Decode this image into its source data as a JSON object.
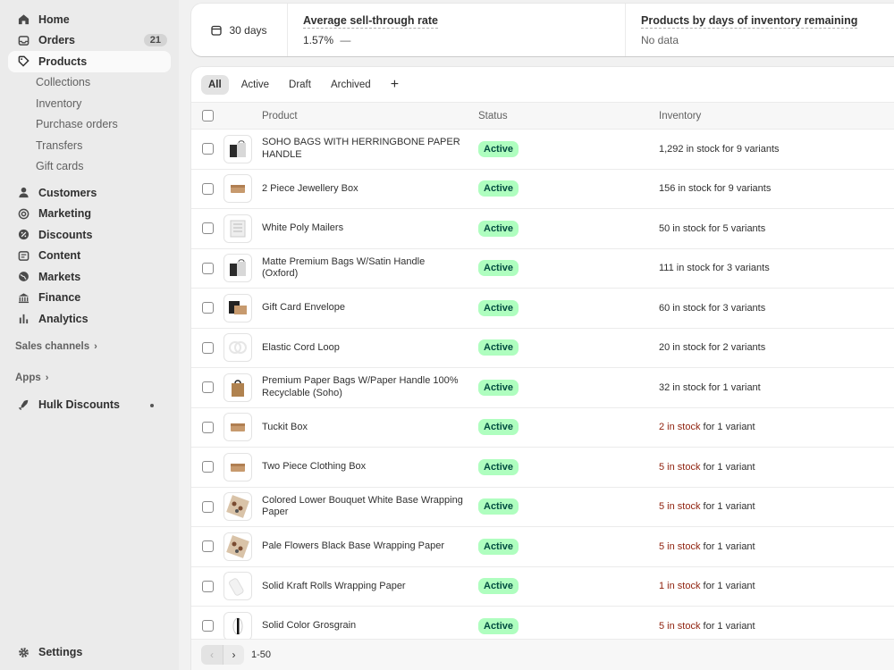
{
  "sidebar": {
    "items": [
      {
        "label": "Home"
      },
      {
        "label": "Orders",
        "badge": "21"
      },
      {
        "label": "Products"
      },
      {
        "label": "Customers"
      },
      {
        "label": "Marketing"
      },
      {
        "label": "Discounts"
      },
      {
        "label": "Content"
      },
      {
        "label": "Markets"
      },
      {
        "label": "Finance"
      },
      {
        "label": "Analytics"
      }
    ],
    "product_subitems": [
      "Collections",
      "Inventory",
      "Purchase orders",
      "Transfers",
      "Gift cards"
    ],
    "sales_channels": "Sales channels",
    "apps": "Apps",
    "app_item": "Hulk Discounts",
    "settings": "Settings"
  },
  "stats": {
    "range": "30 days",
    "sell_through_title": "Average sell-through rate",
    "sell_through_value": "1.57%",
    "sell_through_trend": "—",
    "inventory_title": "Products by days of inventory remaining",
    "inventory_value": "No data"
  },
  "tabs": [
    "All",
    "Active",
    "Draft",
    "Archived"
  ],
  "tab_add": "+",
  "table": {
    "headers": {
      "product": "Product",
      "status": "Status",
      "inventory": "Inventory"
    },
    "rows": [
      {
        "name": "SOHO BAGS WITH HERRINGBONE PAPER HANDLE",
        "status": "Active",
        "stock": "1,292 in stock",
        "variants": " for 9 variants",
        "low": false
      },
      {
        "name": "2 Piece Jewellery Box",
        "status": "Active",
        "stock": "156 in stock",
        "variants": " for 9 variants",
        "low": false
      },
      {
        "name": "White Poly Mailers",
        "status": "Active",
        "stock": "50 in stock",
        "variants": " for 5 variants",
        "low": false
      },
      {
        "name": "Matte Premium Bags W/Satin Handle (Oxford)",
        "status": "Active",
        "stock": "111 in stock",
        "variants": " for 3 variants",
        "low": false
      },
      {
        "name": "Gift Card Envelope",
        "status": "Active",
        "stock": "60 in stock",
        "variants": " for 3 variants",
        "low": false
      },
      {
        "name": "Elastic Cord Loop",
        "status": "Active",
        "stock": "20 in stock",
        "variants": " for 2 variants",
        "low": false
      },
      {
        "name": "Premium Paper Bags W/Paper Handle 100% Recyclable (Soho)",
        "status": "Active",
        "stock": "32 in stock",
        "variants": " for 1 variant",
        "low": false
      },
      {
        "name": "Tuckit Box",
        "status": "Active",
        "stock": "2 in stock",
        "variants": " for 1 variant",
        "low": true
      },
      {
        "name": "Two Piece Clothing Box",
        "status": "Active",
        "stock": "5 in stock",
        "variants": " for 1 variant",
        "low": true
      },
      {
        "name": "Colored Lower Bouquet White Base Wrapping Paper",
        "status": "Active",
        "stock": "5 in stock",
        "variants": " for 1 variant",
        "low": true
      },
      {
        "name": "Pale Flowers Black Base Wrapping Paper",
        "status": "Active",
        "stock": "5 in stock",
        "variants": " for 1 variant",
        "low": true
      },
      {
        "name": "Solid Kraft Rolls Wrapping Paper",
        "status": "Active",
        "stock": "1 in stock",
        "variants": " for 1 variant",
        "low": true
      },
      {
        "name": "Solid Color Grosgrain",
        "status": "Active",
        "stock": "5 in stock",
        "variants": " for 1 variant",
        "low": true
      }
    ]
  },
  "pagination": {
    "prev": "‹",
    "next": "›",
    "range": "1-50"
  },
  "colors": {
    "active_badge_bg": "#affebf",
    "active_badge_text": "#014b40",
    "low_stock": "#8e1f0b"
  },
  "thumb_icons": [
    "bag-thumbnail-icon",
    "box-thumbnail-icon",
    "mailer-thumbnail-icon",
    "bag-thumbnail-icon",
    "envelope-thumbnail-icon",
    "cord-thumbnail-icon",
    "paper-bag-thumbnail-icon",
    "box-thumbnail-icon",
    "box-thumbnail-icon",
    "wrapping-paper-thumbnail-icon",
    "wrapping-paper-thumbnail-icon",
    "roll-thumbnail-icon",
    "ribbon-thumbnail-icon"
  ]
}
